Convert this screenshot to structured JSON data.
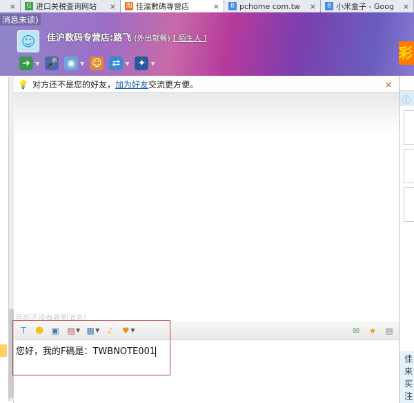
{
  "tabs": [
    {
      "label": "",
      "favicon": "",
      "active": false
    },
    {
      "label": "进口关税查询网站",
      "favicon": "G",
      "color": "#3ca24a",
      "active": false
    },
    {
      "label": "佳滬數碼專營店",
      "favicon": "淘",
      "color": "#f07020",
      "active": true
    },
    {
      "label": "pchome com.tw",
      "favicon": "8",
      "color": "#4a8af0",
      "active": false
    },
    {
      "label": "小米盒子 - Goog",
      "favicon": "8",
      "color": "#4a8af0",
      "active": false
    }
  ],
  "header": {
    "unread": "消息未读)",
    "contact_name": "佳沪数码专营店:路飞",
    "status": "(外出就餐)",
    "relation": "[ 陌生人 ]",
    "promo": "彩"
  },
  "toolbar": [
    {
      "icon": "file-transfer-icon",
      "glyph": "➜",
      "color": "#3a9a4a",
      "dropdown": true
    },
    {
      "icon": "microphone-icon",
      "glyph": "🎤",
      "color": "#4a6ab0",
      "dropdown": false
    },
    {
      "icon": "webcam-icon",
      "glyph": "◉",
      "color": "#6aa8d8",
      "dropdown": true
    },
    {
      "icon": "add-contact-icon",
      "glyph": "☺",
      "color": "#e08a30",
      "dropdown": false
    },
    {
      "icon": "remote-assist-icon",
      "glyph": "⇄",
      "color": "#3a8ad0",
      "dropdown": true
    },
    {
      "icon": "app-icon",
      "glyph": "✦",
      "color": "#2a5a9a",
      "dropdown": true
    }
  ],
  "notice": {
    "text_before": "对方还不是您的好友，",
    "link": "加为好友",
    "text_after": "交流更方便。",
    "close": "×"
  },
  "history": {
    "empty_text": "目前还没有收到消息!"
  },
  "input_toolbar": [
    {
      "icon": "font-icon",
      "glyph": "T",
      "color": "#3a8ad0",
      "dropdown": false
    },
    {
      "icon": "emoji-icon",
      "glyph": "☻",
      "color": "#f0b800",
      "dropdown": false
    },
    {
      "icon": "screenshot-icon",
      "glyph": "▣",
      "color": "#4a7ab0",
      "dropdown": false
    },
    {
      "icon": "image-icon",
      "glyph": "▤",
      "color": "#b05a6a",
      "dropdown": true
    },
    {
      "icon": "quick-reply-icon",
      "glyph": "▦",
      "color": "#4a7ab0",
      "dropdown": true
    },
    {
      "icon": "shake-icon",
      "glyph": "♪",
      "color": "#f0b000",
      "dropdown": false
    },
    {
      "icon": "heart-icon",
      "glyph": "♥",
      "color": "#f08a30",
      "dropdown": true
    }
  ],
  "input_right": [
    {
      "icon": "chat-history-icon",
      "glyph": "✉",
      "color": "#5a9a5a"
    },
    {
      "icon": "favorite-message-icon",
      "glyph": "★",
      "color": "#e0a020"
    },
    {
      "icon": "message-settings-icon",
      "glyph": "▤",
      "color": "#8a8a8a"
    }
  ],
  "editor": {
    "value": "您好，我的F碼是：TWBNOTE001"
  },
  "right_panel": {
    "lines": [
      "佳",
      "来",
      "买",
      "注"
    ]
  }
}
